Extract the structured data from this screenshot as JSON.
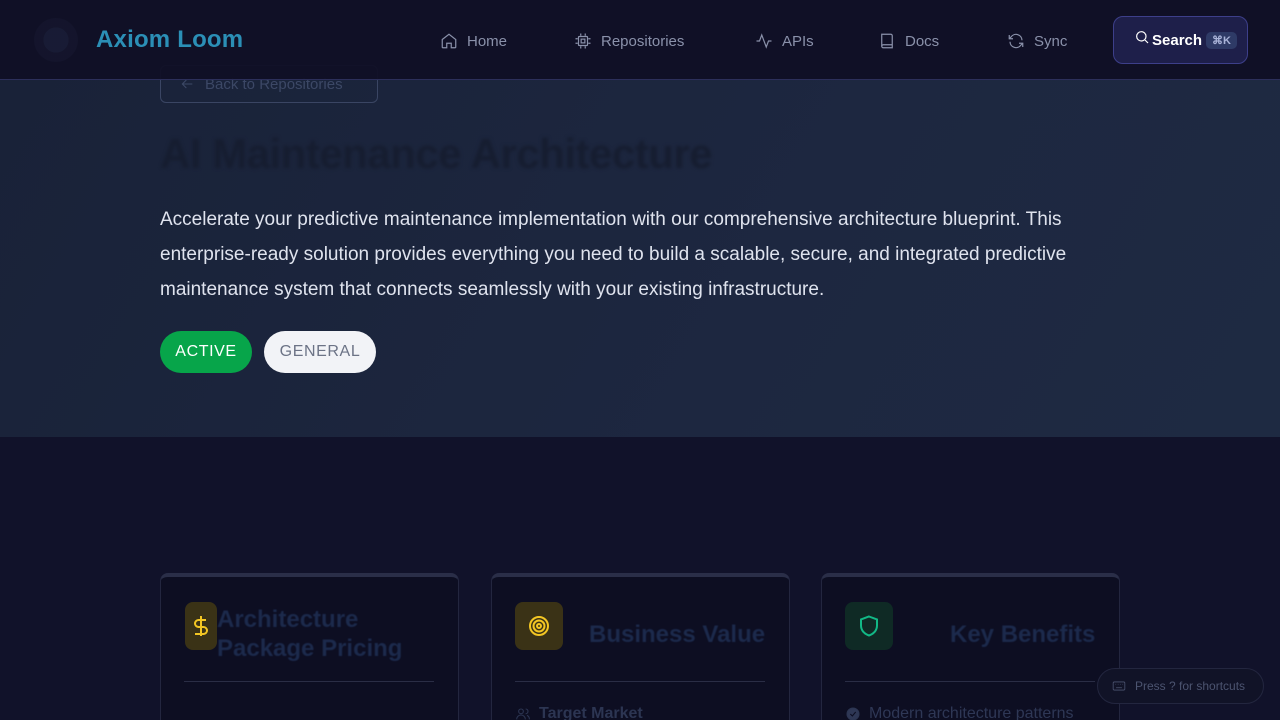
{
  "brand": {
    "name": "Axiom Loom"
  },
  "nav": {
    "items": [
      {
        "label": "Home",
        "icon": "home-icon"
      },
      {
        "label": "Repositories",
        "icon": "chip-icon"
      },
      {
        "label": "APIs",
        "icon": "activity-icon"
      },
      {
        "label": "Docs",
        "icon": "book-icon"
      },
      {
        "label": "Sync",
        "icon": "refresh-icon"
      }
    ],
    "search_label": "Search",
    "search_shortcut": "⌘K"
  },
  "hero": {
    "back_label": "Back to Repositories",
    "title": "AI Maintenance Architecture",
    "description": "Accelerate your predictive maintenance implementation with our comprehensive architecture blueprint. This enterprise-ready solution provides everything you need to build a scalable, secure, and integrated predictive maintenance system that connects seamlessly with your existing infrastructure.",
    "status_badge": "ACTIVE",
    "category_badge": "GENERAL"
  },
  "cards": [
    {
      "title_line1": "Architecture",
      "title_line2": "Package Pricing",
      "icon": "dollar-icon"
    },
    {
      "title": "Business Value",
      "icon": "target-icon",
      "subheading": "Target Market"
    },
    {
      "title": "Key Benefits",
      "icon": "shield-icon",
      "first_item": "Modern architecture patterns"
    }
  ],
  "shortcut_hint": "Press ? for shortcuts",
  "colors": {
    "background": "#11122a",
    "brand": "#2b8fb6",
    "active_badge": "#07a54a",
    "search_button": "#1e1f4a"
  }
}
